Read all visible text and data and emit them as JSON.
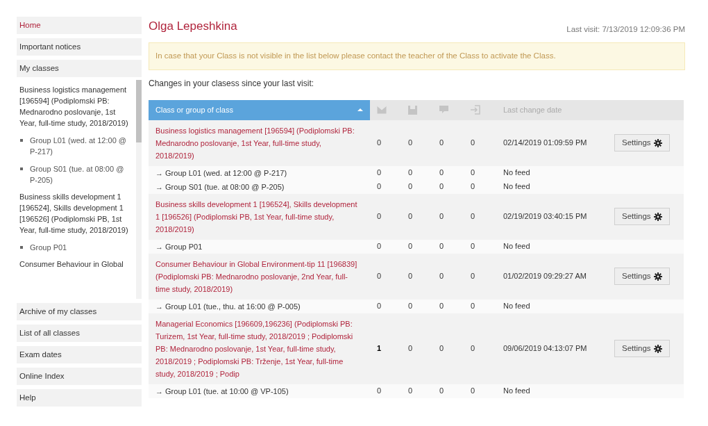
{
  "sidebar": {
    "items_top": [
      {
        "label": "Home",
        "selected": true
      },
      {
        "label": "Important notices",
        "selected": false
      },
      {
        "label": "My classes",
        "selected": false
      }
    ],
    "my_classes": [
      {
        "name": "Business logistics management [196594] (Podiplomski PB: Mednarodno poslovanje, 1st Year, full-time study, 2018/2019)",
        "groups": [
          "Group L01 (wed. at 12:00 @ P-217)",
          "Group S01 (tue. at 08:00 @ P-205)"
        ]
      },
      {
        "name": "Business skills development 1 [196524], Skills development 1 [196526] (Podiplomski PB, 1st Year, full-time study, 2018/2019)",
        "groups": [
          "Group P01"
        ]
      },
      {
        "name": "Consumer Behaviour in Global"
      }
    ],
    "items_bottom": [
      {
        "label": "Archive of my classes",
        "selected": false
      },
      {
        "label": "List of all classes",
        "selected": false
      },
      {
        "label": "Exam dates",
        "selected": false
      },
      {
        "label": "Online Index",
        "selected": false
      },
      {
        "label": "Help",
        "selected": false
      }
    ]
  },
  "user_name": "Olga Lepeshkina",
  "last_visit": "Last visit: 7/13/2019 12:09:36 PM",
  "notice": "In case that your Class is not visible in the list below please contact the teacher of the Class to activate the Class.",
  "changes_heading": "Changes in your clasess since your last visit:",
  "table": {
    "name_header": "Class or group of class",
    "sorted": true,
    "date_header": "Last change date",
    "rows": [
      {
        "kind": "class",
        "name": "Business logistics management [196594] (Podiplomski PB: Mednarodno poslovanje, 1st Year, full-time study, 2018/2019)",
        "counts": [
          {
            "value": "0",
            "new": false
          },
          {
            "value": "0",
            "new": false
          },
          {
            "value": "0",
            "new": false
          },
          {
            "value": "0",
            "new": false
          }
        ],
        "date": "02/14/2019 01:09:59 PM",
        "button": "Settings"
      },
      {
        "kind": "group",
        "arrow": "→",
        "name": "Group L01 (wed. at 12:00 @ P-217)",
        "counts": [
          {
            "value": "0",
            "new": false
          },
          {
            "value": "0",
            "new": false
          },
          {
            "value": "0",
            "new": false
          },
          {
            "value": "0",
            "new": false
          }
        ],
        "date": "No feed"
      },
      {
        "kind": "group",
        "arrow": "→",
        "name": "Group S01 (tue. at 08:00 @ P-205)",
        "counts": [
          {
            "value": "0",
            "new": false
          },
          {
            "value": "0",
            "new": false
          },
          {
            "value": "0",
            "new": false
          },
          {
            "value": "0",
            "new": false
          }
        ],
        "date": "No feed"
      },
      {
        "kind": "class",
        "name": "Business skills development 1 [196524], Skills development 1 [196526] (Podiplomski PB, 1st Year, full-time study, 2018/2019)",
        "counts": [
          {
            "value": "0",
            "new": false
          },
          {
            "value": "0",
            "new": false
          },
          {
            "value": "0",
            "new": false
          },
          {
            "value": "0",
            "new": false
          }
        ],
        "date": "02/19/2019 03:40:15 PM",
        "button": "Settings"
      },
      {
        "kind": "group",
        "arrow": "→",
        "name": "Group P01",
        "counts": [
          {
            "value": "0",
            "new": false
          },
          {
            "value": "0",
            "new": false
          },
          {
            "value": "0",
            "new": false
          },
          {
            "value": "0",
            "new": false
          }
        ],
        "date": "No feed"
      },
      {
        "kind": "class",
        "name": "Consumer Behaviour in Global Environment-tip 11 [196839] (Podiplomski PB: Mednarodno poslovanje, 2nd Year, full-time study, 2018/2019)",
        "counts": [
          {
            "value": "0",
            "new": false
          },
          {
            "value": "0",
            "new": false
          },
          {
            "value": "0",
            "new": false
          },
          {
            "value": "0",
            "new": false
          }
        ],
        "date": "01/02/2019 09:29:27 AM",
        "button": "Settings"
      },
      {
        "kind": "group",
        "arrow": "→",
        "name": "Group L01 (tue., thu. at 16:00 @ P-005)",
        "counts": [
          {
            "value": "0",
            "new": false
          },
          {
            "value": "0",
            "new": false
          },
          {
            "value": "0",
            "new": false
          },
          {
            "value": "0",
            "new": false
          }
        ],
        "date": "No feed"
      },
      {
        "kind": "class",
        "name": "Managerial Economics [196609,196236] (Podiplomski PB: Turizem, 1st Year, full-time study, 2018/2019 ; Podiplomski PB: Mednarodno poslovanje, 1st Year, full-time study, 2018/2019 ; Podiplomski PB: Trženje, 1st Year, full-time study, 2018/2019 ; Podip",
        "counts": [
          {
            "value": "1",
            "new": true
          },
          {
            "value": "0",
            "new": false
          },
          {
            "value": "0",
            "new": false
          },
          {
            "value": "0",
            "new": false
          }
        ],
        "date": "09/06/2019 04:13:07 PM",
        "button": "Settings"
      },
      {
        "kind": "group",
        "arrow": "→",
        "name": "Group L01 (tue. at 10:00 @ VP-105)",
        "counts": [
          {
            "value": "0",
            "new": false
          },
          {
            "value": "0",
            "new": false
          },
          {
            "value": "0",
            "new": false
          },
          {
            "value": "0",
            "new": false
          }
        ],
        "date": "No feed"
      }
    ]
  }
}
